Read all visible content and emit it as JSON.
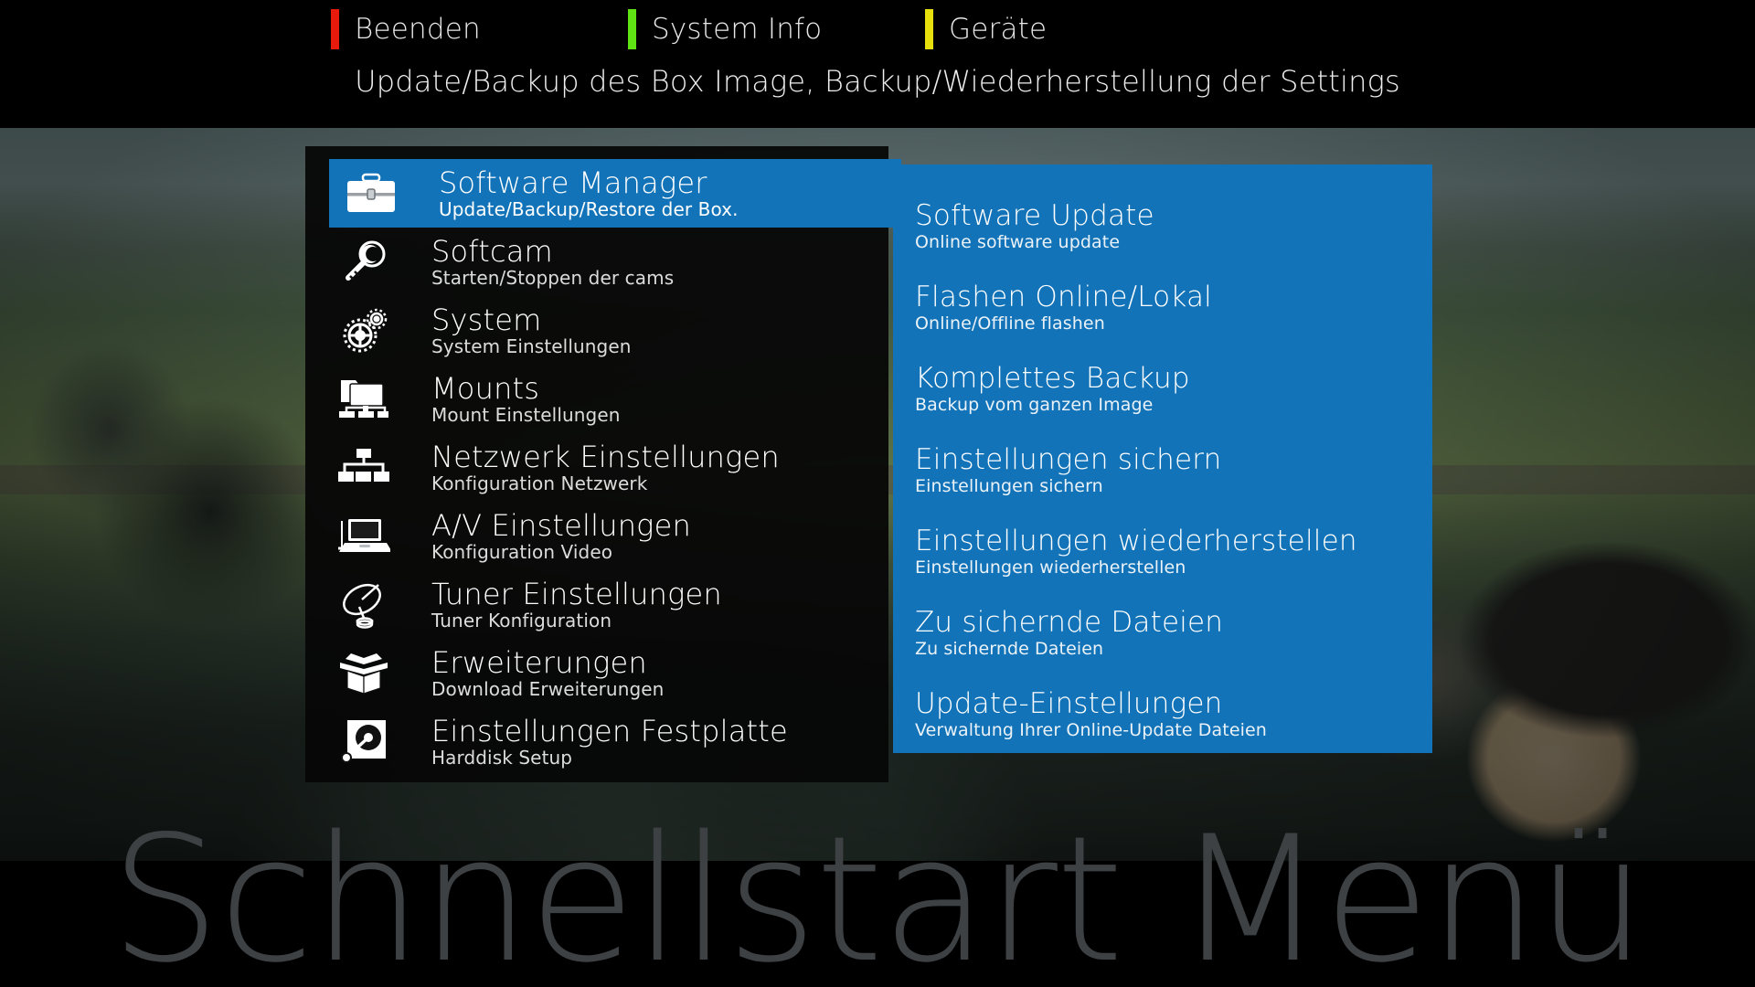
{
  "header": {
    "buttons": [
      {
        "label": "Beenden",
        "color": "#e81a0c",
        "name": "red"
      },
      {
        "label": "System Info",
        "color": "#5fe312",
        "name": "green"
      },
      {
        "label": "Geräte",
        "color": "#e8e00c",
        "name": "yellow"
      }
    ],
    "subtitle": "Update/Backup des Box Image, Backup/Wiederherstellung der Settings"
  },
  "menu": {
    "selected_index": 0,
    "highlight_color": "#1273b8",
    "items": [
      {
        "title": "Software Manager",
        "subtitle": "Update/Backup/Restore der Box.",
        "icon": "briefcase-icon"
      },
      {
        "title": "Softcam",
        "subtitle": "Starten/Stoppen der cams",
        "icon": "key-icon"
      },
      {
        "title": "System",
        "subtitle": "System Einstellungen",
        "icon": "gears-icon"
      },
      {
        "title": "Mounts",
        "subtitle": "Mount Einstellungen",
        "icon": "network-folder-icon"
      },
      {
        "title": "Netzwerk Einstellungen",
        "subtitle": "Konfiguration Netzwerk",
        "icon": "network-tree-icon"
      },
      {
        "title": "A/V Einstellungen",
        "subtitle": "Konfiguration Video",
        "icon": "laptop-icon"
      },
      {
        "title": "Tuner Einstellungen",
        "subtitle": "Tuner Konfiguration",
        "icon": "satellite-dish-icon"
      },
      {
        "title": "Erweiterungen",
        "subtitle": "Download Erweiterungen",
        "icon": "open-box-icon"
      },
      {
        "title": "Einstellungen Festplatte",
        "subtitle": "Harddisk Setup",
        "icon": "harddisk-icon"
      }
    ]
  },
  "submenu": {
    "background_color": "#1273b8",
    "items": [
      {
        "title": "Software Update",
        "subtitle": "Online software update"
      },
      {
        "title": "Flashen Online/Lokal",
        "subtitle": "Online/Offline flashen"
      },
      {
        "title": "Komplettes Backup",
        "subtitle": "Backup vom ganzen Image"
      },
      {
        "title": "Einstellungen sichern",
        "subtitle": "Einstellungen sichern"
      },
      {
        "title": "Einstellungen wiederherstellen",
        "subtitle": "Einstellungen wiederherstellen"
      },
      {
        "title": "Zu sichernde Dateien",
        "subtitle": "Zu sichernde Dateien"
      },
      {
        "title": "Update-Einstellungen",
        "subtitle": "Verwaltung Ihrer Online-Update Dateien"
      }
    ]
  },
  "watermark": {
    "text": "Schnellstart Menü",
    "color": "#3e4144"
  }
}
